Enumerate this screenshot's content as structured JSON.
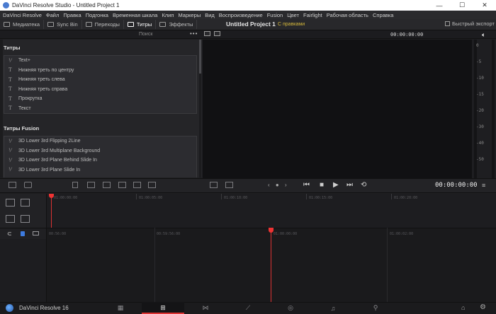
{
  "window": {
    "title": "DaVinci Resolve Studio - Untitled Project 1",
    "minimize": "—",
    "maximize": "☐",
    "close": "✕"
  },
  "menu": [
    "DaVinci Resolve",
    "Файл",
    "Правка",
    "Подгонка",
    "Временная шкала",
    "Клип",
    "Маркеры",
    "Вид",
    "Воспроизведение",
    "Fusion",
    "Цвет",
    "Fairlight",
    "Рабочая область",
    "Справка"
  ],
  "toolbar": {
    "media_pool": "Медиатека",
    "sync_bin": "Sync Bin",
    "transitions": "Переходы",
    "titles": "Титры",
    "effects": "Эффекты",
    "project_title": "Untitled Project 1",
    "project_status": "С правками",
    "quick_export": "Быстрый экспорт"
  },
  "subbar": {
    "search_label": "Поиск",
    "more": "•••",
    "timecode": "00:00:00:00"
  },
  "titles_section": {
    "heading": "Титры",
    "items": [
      {
        "glyph": "⅟",
        "label": "Text+"
      },
      {
        "glyph": "T",
        "label": "Нижняя треть по центру"
      },
      {
        "glyph": "T",
        "label": "Нижняя треть слева"
      },
      {
        "glyph": "T",
        "label": "Нижняя треть справа"
      },
      {
        "glyph": "T",
        "label": "Прокрутка"
      },
      {
        "glyph": "T",
        "label": "Текст"
      }
    ]
  },
  "fusion_section": {
    "heading": "Титры Fusion",
    "items": [
      {
        "glyph": "⅟",
        "label": "3D Lower 3rd Flipping 2Line"
      },
      {
        "glyph": "⅟",
        "label": "3D Lower 3rd Multiplane Background"
      },
      {
        "glyph": "⅟",
        "label": "3D Lower 3rd Plane Behind Slide In"
      },
      {
        "glyph": "⅟",
        "label": "3D Lower 3rd Plane Slide In"
      }
    ]
  },
  "meters": {
    "labels": [
      "0",
      "-5",
      "-10",
      "-15",
      "-20",
      "-30",
      "-40",
      "-50"
    ]
  },
  "transport": {
    "jog": "‹ ● ›",
    "prev": "⏮",
    "stop": "■",
    "play": "▶",
    "next": "⏭",
    "loop": "⟲",
    "timecode": "00:00:00:00",
    "menu": "≡"
  },
  "ruler_upper": [
    "01:00:00:00",
    "01:00:05:00",
    "01:00:10:00",
    "01:00:15:00",
    "01:00:20:00"
  ],
  "ruler_lower": [
    "00:56:00",
    "00:59:56:00",
    "01:00:00:00",
    "01:00:02:00"
  ],
  "pagebar": {
    "brand": "DaVinci Resolve 16",
    "tabs": [
      "▦",
      "⊞",
      "⋈",
      "⟋",
      "◎",
      "♫",
      "⚲"
    ],
    "home": "⌂",
    "settings": "⚙"
  }
}
